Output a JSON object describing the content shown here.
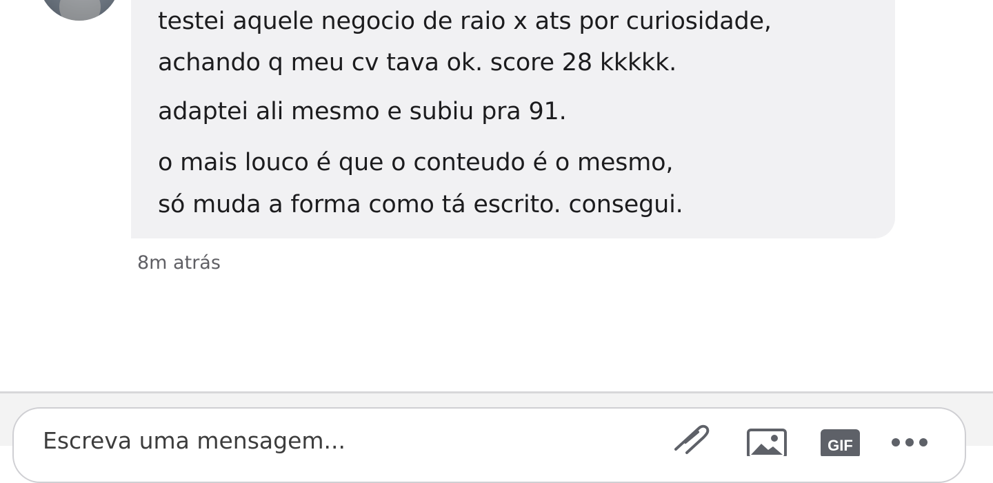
{
  "message": {
    "lines": [
      "testei aquele negocio de raio x ats por curiosidade,",
      "achando q meu cv tava ok. score 28 kkkkk.",
      "adaptei ali mesmo e subiu pra 91.",
      "o mais louco é que o conteudo é o mesmo,",
      "só muda a forma como tá escrito. consegui."
    ],
    "timestamp": "8m atrás"
  },
  "composer": {
    "placeholder": "Escreva uma mensagem...",
    "gif_label": "GIF"
  },
  "icons": {
    "attach": "paperclip-icon",
    "image": "image-icon",
    "gif": "gif-icon",
    "more": "more-icon"
  },
  "colors": {
    "bubble": "#f1f1f3",
    "text": "#1c1c1e",
    "icon": "#5e6168"
  }
}
